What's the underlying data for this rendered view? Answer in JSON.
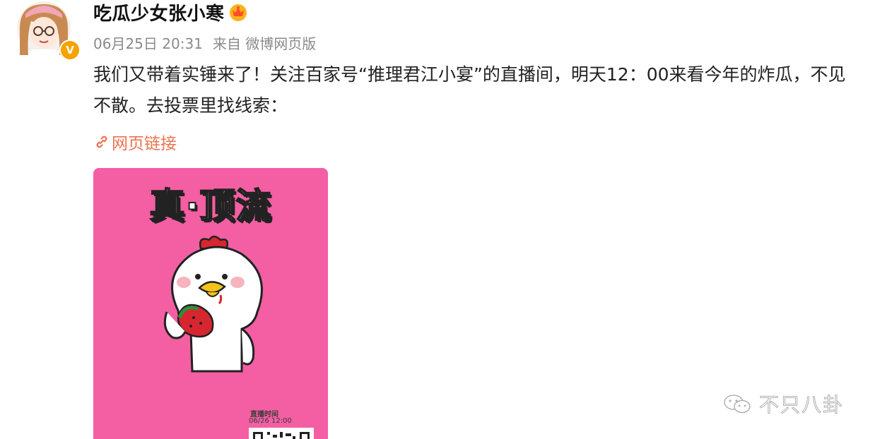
{
  "user": {
    "name": "吃瓜少女张小寒",
    "verified_mark": "V"
  },
  "meta": {
    "timestamp": "06月25日 20:31",
    "source": "来自 微博网页版"
  },
  "post": {
    "text": "我们又带着实锤来了！关注百家号“推理君江小宴”的直播间，明天12：00来看今年的炸瓜，不见不散。去投票里找线索：",
    "link_label": "网页链接"
  },
  "poster": {
    "title": "真·顶流",
    "live_time_label": "直播时间",
    "live_time_value": "06/26 12:00"
  },
  "watermark": {
    "text": "不只八卦"
  },
  "colors": {
    "link": "#eb7350",
    "poster_bg": "#f35fa2",
    "meta_text": "#8a8a8a"
  },
  "icons": [
    "avatar",
    "verified-badge-icon",
    "vip-crown-icon",
    "link-chain-icon",
    "wechat-watermark-icon"
  ]
}
